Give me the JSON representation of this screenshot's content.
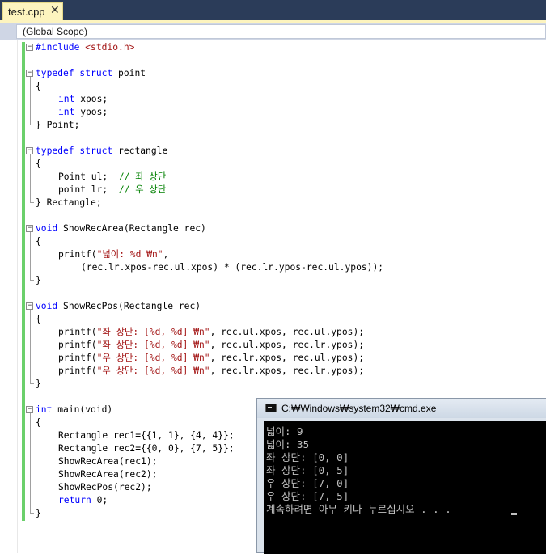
{
  "tab": {
    "label": "test.cpp",
    "close": "✕"
  },
  "scope": {
    "label": "(Global Scope)"
  },
  "code": {
    "l1": {
      "kw": "#include",
      "str": "<stdio.h>"
    },
    "l3": {
      "kw1": "typedef",
      "kw2": "struct",
      "rest": " point"
    },
    "l4": "{",
    "l5": {
      "kw": "int",
      "rest": " xpos;"
    },
    "l6": {
      "kw": "int",
      "rest": " ypos;"
    },
    "l7": "} Point;",
    "l9": {
      "kw1": "typedef",
      "kw2": "struct",
      "rest": " rectangle"
    },
    "l10": "{",
    "l11": {
      "code": "Point ul;  ",
      "cmt": "// 좌 상단"
    },
    "l12": {
      "code": "point lr;  ",
      "cmt": "// 우 상단"
    },
    "l13": "} Rectangle;",
    "l15": {
      "kw": "void",
      "rest": " ShowRecArea(Rectangle rec)"
    },
    "l16": "{",
    "l17": {
      "pre": "printf(",
      "str": "\"넓이: %d ₩n\"",
      "post": ","
    },
    "l18": "(rec.lr.xpos-rec.ul.xpos) * (rec.lr.ypos-rec.ul.ypos));",
    "l19": "}",
    "l21": {
      "kw": "void",
      "rest": " ShowRecPos(Rectangle rec)"
    },
    "l22": "{",
    "l23": {
      "pre": "printf(",
      "str": "\"좌 상단: [%d, %d] ₩n\"",
      "post": ", rec.ul.xpos, rec.ul.ypos);"
    },
    "l24": {
      "pre": "printf(",
      "str": "\"좌 상단: [%d, %d] ₩n\"",
      "post": ", rec.ul.xpos, rec.lr.ypos);"
    },
    "l25": {
      "pre": "printf(",
      "str": "\"우 상단: [%d, %d] ₩n\"",
      "post": ", rec.lr.xpos, rec.ul.ypos);"
    },
    "l26": {
      "pre": "printf(",
      "str": "\"우 상단: [%d, %d] ₩n\"",
      "post": ", rec.lr.xpos, rec.lr.ypos);"
    },
    "l27": "}",
    "l29": {
      "kw": "int",
      "rest": " main(void)"
    },
    "l30": "{",
    "l31": "Rectangle rec1={{1, 1}, {4, 4}};",
    "l32": "Rectangle rec2={{0, 0}, {7, 5}};",
    "l33": "ShowRecArea(rec1);",
    "l34": "ShowRecArea(rec2);",
    "l35": "ShowRecPos(rec2);",
    "l36": {
      "kw": "return",
      "rest": " 0;"
    },
    "l37": "}"
  },
  "console": {
    "title": "C:₩Windows₩system32₩cmd.exe",
    "lines": [
      "넓이: 9",
      "넓이: 35",
      "좌 상단: [0, 0]",
      "좌 상단: [0, 5]",
      "우 상단: [7, 0]",
      "우 상단: [7, 5]",
      "계속하려면 아무 키나 누르십시오 . . ."
    ]
  }
}
